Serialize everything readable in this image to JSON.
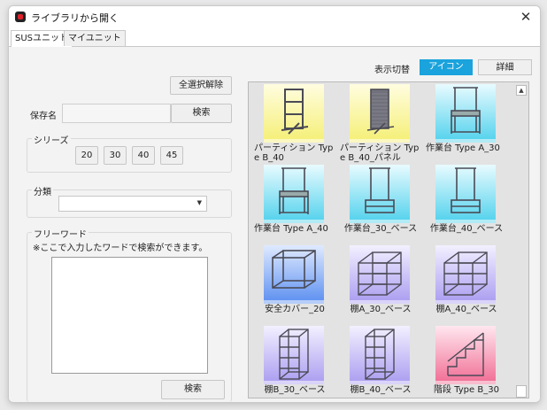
{
  "window": {
    "title": "ライブラリから開く",
    "close_glyph": "✕"
  },
  "tabs": [
    {
      "label": "SUSユニット",
      "active": true
    },
    {
      "label": "マイユニット",
      "active": false
    }
  ],
  "left_panel": {
    "deselect_all_label": "全選択解除",
    "save_name_label": "保存名",
    "save_name_value": "",
    "search_label": "検索",
    "series": {
      "title": "シリーズ",
      "buttons": [
        "20",
        "30",
        "40",
        "45"
      ]
    },
    "category": {
      "title": "分類",
      "selected": ""
    },
    "freeword": {
      "title": "フリーワード",
      "hint": "※ここで入力したワードで検索ができます。",
      "value": "",
      "search_label": "検索"
    }
  },
  "view_toggle": {
    "label": "表示切替",
    "icon_label": "アイコン",
    "detail_label": "詳細",
    "active": "icon",
    "active_color": "#1aa3dc"
  },
  "gallery": {
    "items": [
      {
        "label": "パーティション Type B_40",
        "icon": "partition-frame",
        "bg": "yellow"
      },
      {
        "label": "パーティション Type B_40_パネル",
        "icon": "partition-panel",
        "bg": "yellow"
      },
      {
        "label": "作業台 Type A_30",
        "icon": "workbench",
        "bg": "cyan"
      },
      {
        "label": "作業台 Type A_40",
        "icon": "workbench",
        "bg": "cyan"
      },
      {
        "label": "作業台_30_ベース",
        "icon": "workbench-base",
        "bg": "cyan"
      },
      {
        "label": "作業台_40_ベース",
        "icon": "workbench-base",
        "bg": "cyan"
      },
      {
        "label": "安全カバー_20",
        "icon": "safety-cover",
        "bg": "blue"
      },
      {
        "label": "棚A_30_ベース",
        "icon": "shelf-wide",
        "bg": "lavender"
      },
      {
        "label": "棚A_40_ベース",
        "icon": "shelf-wide",
        "bg": "lavender"
      },
      {
        "label": "棚B_30_ベース",
        "icon": "shelf-tall",
        "bg": "lavender"
      },
      {
        "label": "棚B_40_ベース",
        "icon": "shelf-tall",
        "bg": "lavender"
      },
      {
        "label": "階段 Type B_30",
        "icon": "stairs",
        "bg": "pink"
      }
    ]
  },
  "colors": {
    "yellow": [
      "#fffde0",
      "#f5ef74"
    ],
    "cyan": [
      "#e8fbff",
      "#4fd1ec"
    ],
    "blue": [
      "#dfeaff",
      "#5a8ef0"
    ],
    "lavender": [
      "#f3f0ff",
      "#a99cf0"
    ],
    "pink": [
      "#ffe7ef",
      "#f06b93"
    ]
  }
}
